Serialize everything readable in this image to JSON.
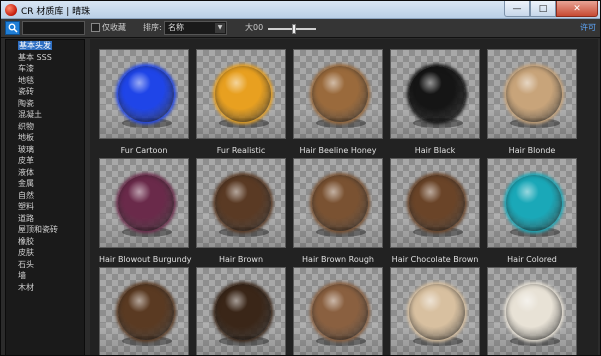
{
  "window": {
    "title": "CR 材质库 | 晴珠",
    "minimize": "—",
    "maximize": "□",
    "close": "✕"
  },
  "toolbar": {
    "search_placeholder": "",
    "favorites_label": "仅收藏",
    "sort_label": "排序:",
    "sort_value": "名称",
    "size_label": "大00",
    "size_level": 0.55,
    "license_label": "许可"
  },
  "sidebar": {
    "items": [
      {
        "label": "基本头发",
        "selected": true
      },
      {
        "label": "基本 SSS"
      },
      {
        "label": "车漆"
      },
      {
        "label": "地毯"
      },
      {
        "label": "瓷砖"
      },
      {
        "label": "陶瓷"
      },
      {
        "label": "混凝土"
      },
      {
        "label": "织物"
      },
      {
        "label": "地板"
      },
      {
        "label": "玻璃"
      },
      {
        "label": "皮革"
      },
      {
        "label": "液体"
      },
      {
        "label": "金属"
      },
      {
        "label": "自然"
      },
      {
        "label": "塑料"
      },
      {
        "label": "道路"
      },
      {
        "label": "屋顶和瓷砖"
      },
      {
        "label": "橡胶"
      },
      {
        "label": "皮肤"
      },
      {
        "label": "石头"
      },
      {
        "label": "墙"
      },
      {
        "label": "木材"
      }
    ]
  },
  "materials": [
    {
      "name": "Fur Cartoon",
      "color": "#1f45e8"
    },
    {
      "name": "Fur Realistic",
      "color": "#e8a020"
    },
    {
      "name": "Hair Beeline Honey",
      "color": "#9a6a3c"
    },
    {
      "name": "Hair Black",
      "color": "#151515"
    },
    {
      "name": "Hair Blonde",
      "color": "#c8a47a"
    },
    {
      "name": "Hair Blowout Burgundy",
      "color": "#6a2a4a"
    },
    {
      "name": "Hair Brown",
      "color": "#5a3a24"
    },
    {
      "name": "Hair Brown Rough",
      "color": "#7a5232"
    },
    {
      "name": "Hair Chocolate Brown",
      "color": "#6a4428"
    },
    {
      "name": "Hair Colored",
      "color": "#1aa8b8"
    },
    {
      "name": "",
      "color": "#5a3a22"
    },
    {
      "name": "",
      "color": "#3a2618"
    },
    {
      "name": "",
      "color": "#8a6040"
    },
    {
      "name": "",
      "color": "#d8c0a0"
    },
    {
      "name": "",
      "color": "#e8e2d6"
    }
  ]
}
